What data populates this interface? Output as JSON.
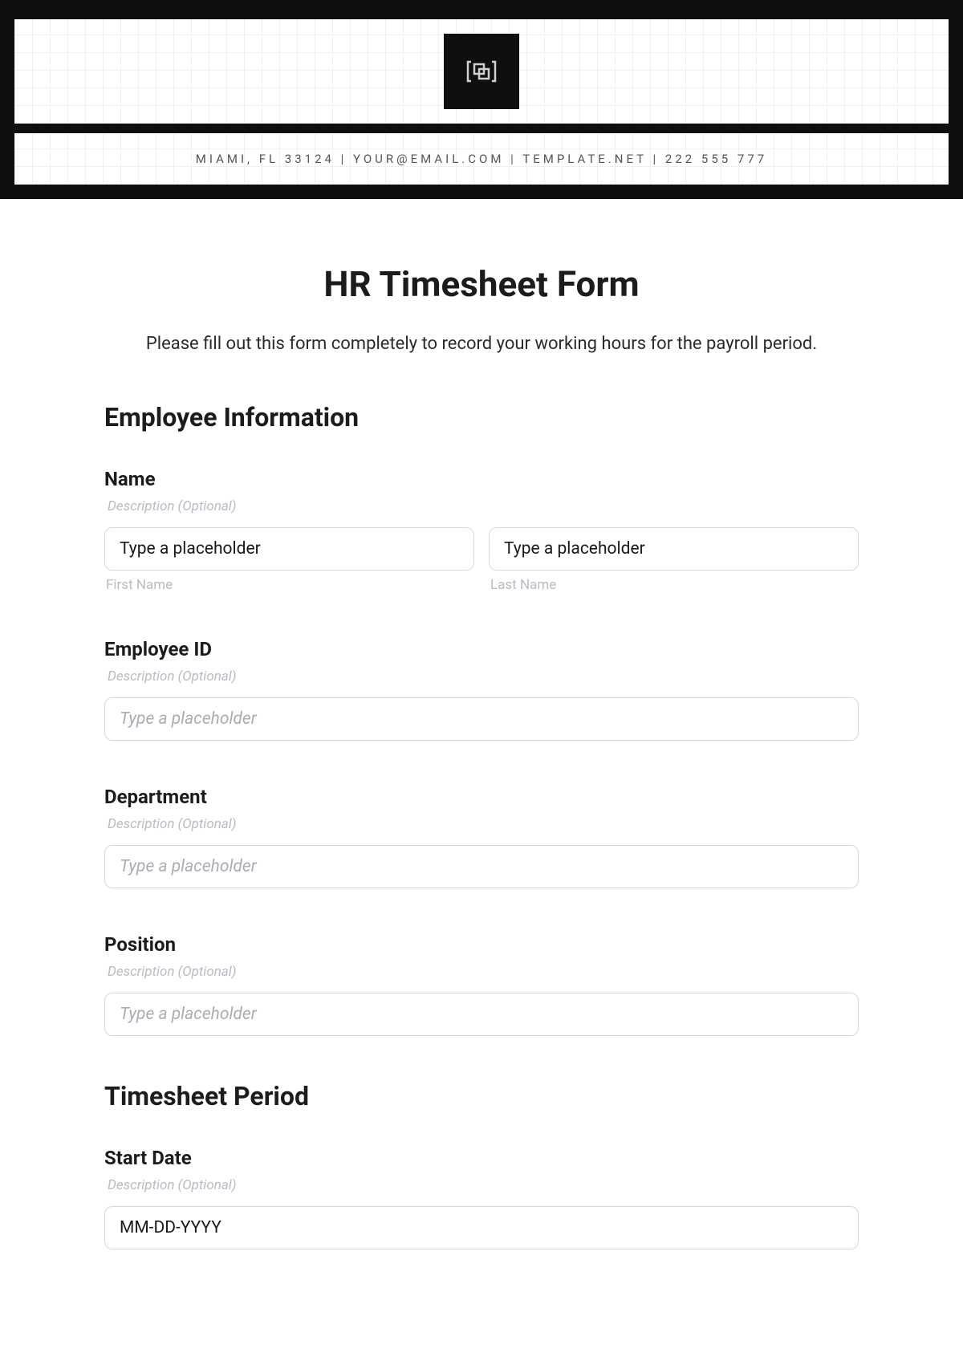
{
  "header": {
    "contact_line": "MIAMI, FL 33124 | YOUR@EMAIL.COM | TEMPLATE.NET | 222 555 777"
  },
  "page": {
    "title": "HR Timesheet Form",
    "intro": "Please fill out this form completely to record your working hours for the payroll period."
  },
  "sections": {
    "employee_info": {
      "heading": "Employee Information",
      "name": {
        "label": "Name",
        "description": "Description (Optional)",
        "first_placeholder": "Type a placeholder",
        "first_sublabel": "First Name",
        "last_placeholder": "Type a placeholder",
        "last_sublabel": "Last Name"
      },
      "employee_id": {
        "label": "Employee ID",
        "description": "Description (Optional)",
        "placeholder": "Type a placeholder"
      },
      "department": {
        "label": "Department",
        "description": "Description (Optional)",
        "placeholder": "Type a placeholder"
      },
      "position": {
        "label": "Position",
        "description": "Description (Optional)",
        "placeholder": "Type a placeholder"
      }
    },
    "timesheet_period": {
      "heading": "Timesheet Period",
      "start_date": {
        "label": "Start Date",
        "description": "Description (Optional)",
        "value": "MM-DD-YYYY"
      }
    }
  }
}
